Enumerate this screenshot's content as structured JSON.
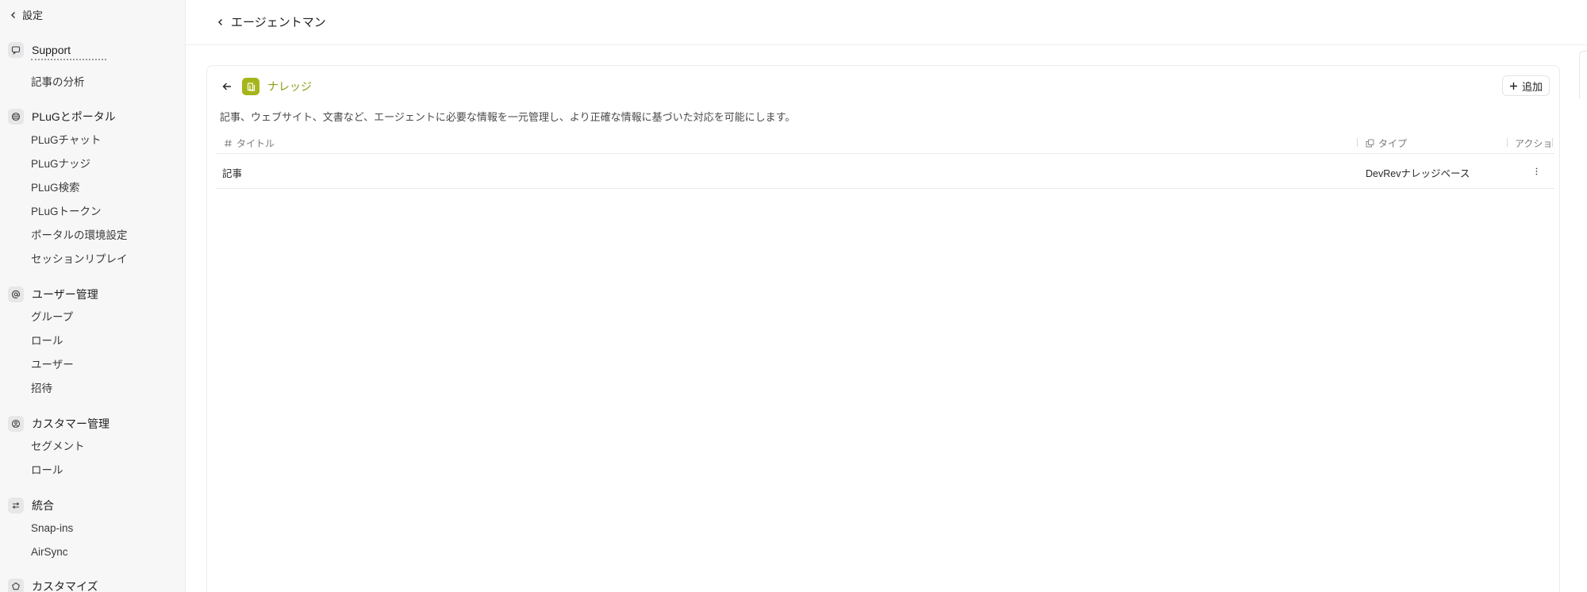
{
  "sidebar": {
    "back_label": "設定",
    "sections": [
      {
        "title": "Support",
        "icon": "chat-bubble-icon",
        "items": [
          "記事の分析"
        ]
      },
      {
        "title": "PLuGとポータル",
        "icon": "globe-icon",
        "items": [
          "PLuGチャット",
          "PLuGナッジ",
          "PLuG検索",
          "PLuGトークン",
          "ポータルの環境設定",
          "セッションリプレイ"
        ]
      },
      {
        "title": "ユーザー管理",
        "icon": "at-sign-icon",
        "items": [
          "グループ",
          "ロール",
          "ユーザー",
          "招待"
        ]
      },
      {
        "title": "カスタマー管理",
        "icon": "customer-icon",
        "items": [
          "セグメント",
          "ロール"
        ]
      },
      {
        "title": "統合",
        "icon": "integration-arrows-icon",
        "items": [
          "Snap-ins",
          "AirSync"
        ]
      },
      {
        "title": "カスタマイズ",
        "icon": "customize-icon",
        "items": []
      }
    ]
  },
  "header": {
    "breadcrumb": "エージェントマン"
  },
  "knowledge": {
    "title": "ナレッジ",
    "add_label": "追加",
    "description": "記事、ウェブサイト、文書など、エージェントに必要な情報を一元管理し、より正確な情報に基づいた対応を可能にします。",
    "columns": {
      "title": "タイトル",
      "type": "タイプ",
      "action": "アクショ"
    },
    "rows": [
      {
        "title": "記事",
        "type": "DevRevナレッジベース"
      }
    ]
  },
  "colors": {
    "accent": "#a6b51a",
    "accent_text": "#8d9c12"
  }
}
